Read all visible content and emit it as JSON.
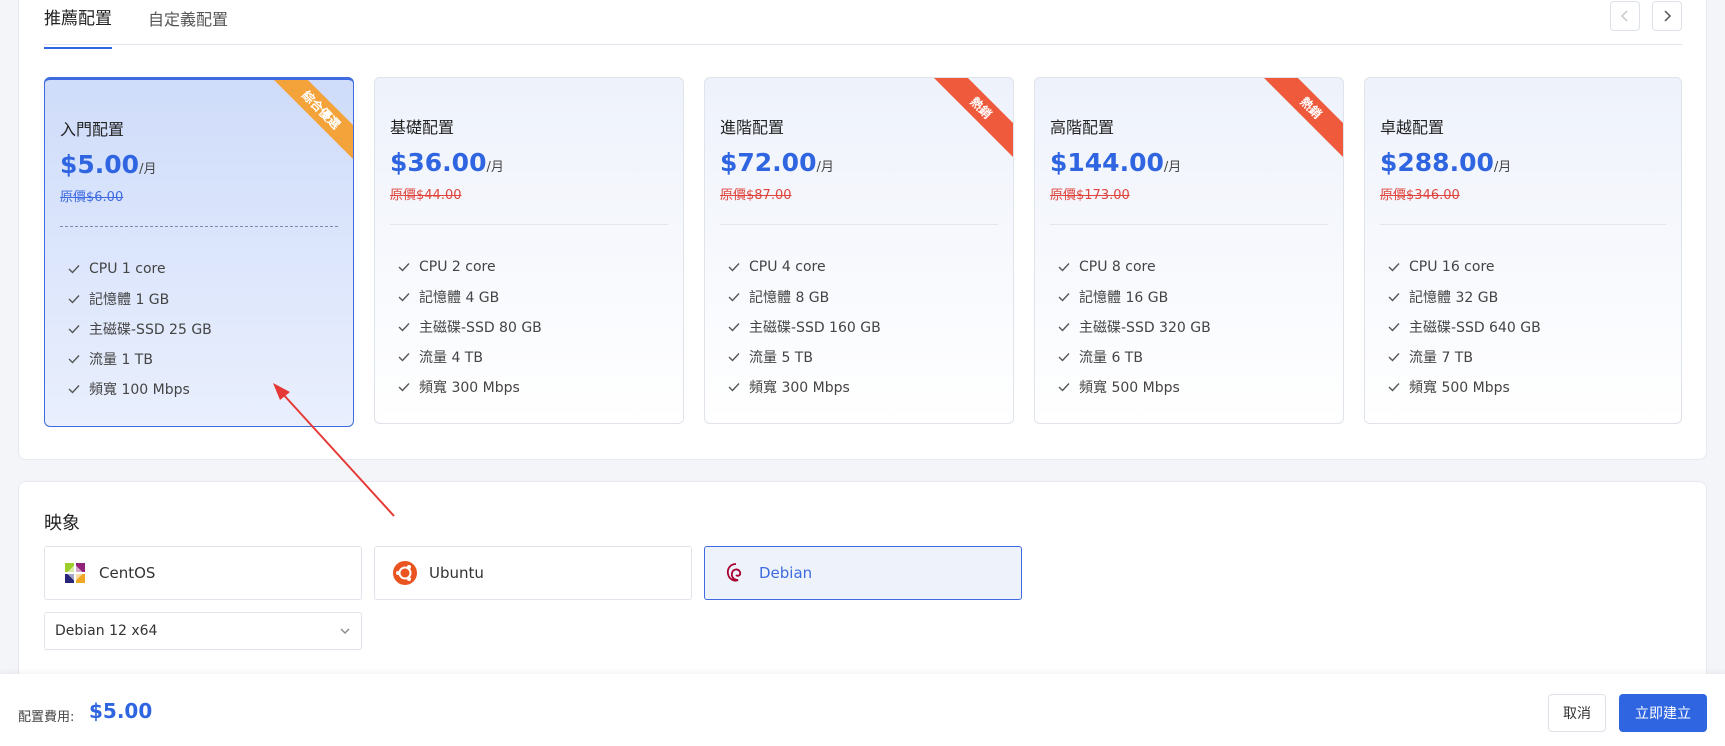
{
  "tabs": {
    "recommended": "推薦配置",
    "custom": "自定義配置"
  },
  "plans": [
    {
      "name": "入門配置",
      "price": "$5.00",
      "unit": "/月",
      "original": "原價$6.00",
      "ribbon": "綜合優選",
      "ribbon_color": "#f4a23a",
      "specs": [
        "CPU 1 core",
        "記憶體 1 GB",
        "主磁碟-SSD 25 GB",
        "流量 1 TB",
        "頻寬 100 Mbps"
      ],
      "selected": true
    },
    {
      "name": "基礎配置",
      "price": "$36.00",
      "unit": "/月",
      "original": "原價$44.00",
      "ribbon": "",
      "specs": [
        "CPU 2 core",
        "記憶體 4 GB",
        "主磁碟-SSD 80 GB",
        "流量 4 TB",
        "頻寬 300 Mbps"
      ]
    },
    {
      "name": "進階配置",
      "price": "$72.00",
      "unit": "/月",
      "original": "原價$87.00",
      "ribbon": "熱銷",
      "ribbon_color": "#ef5a3c",
      "specs": [
        "CPU 4 core",
        "記憶體 8 GB",
        "主磁碟-SSD 160 GB",
        "流量 5 TB",
        "頻寬 300 Mbps"
      ]
    },
    {
      "name": "高階配置",
      "price": "$144.00",
      "unit": "/月",
      "original": "原價$173.00",
      "ribbon": "熱銷",
      "ribbon_color": "#ef5a3c",
      "specs": [
        "CPU 8 core",
        "記憶體 16 GB",
        "主磁碟-SSD 320 GB",
        "流量 6 TB",
        "頻寬 500 Mbps"
      ]
    },
    {
      "name": "卓越配置",
      "price": "$288.00",
      "unit": "/月",
      "original": "原價$346.00",
      "ribbon": "",
      "specs": [
        "CPU 16 core",
        "記憶體 32 GB",
        "主磁碟-SSD 640 GB",
        "流量 7 TB",
        "頻寬 500 Mbps"
      ]
    }
  ],
  "image": {
    "title": "映象",
    "os_options": [
      {
        "label": "CentOS",
        "icon": "centos-icon"
      },
      {
        "label": "Ubuntu",
        "icon": "ubuntu-icon"
      },
      {
        "label": "Debian",
        "icon": "debian-icon",
        "selected": true
      }
    ],
    "version": "Debian 12 x64"
  },
  "footer": {
    "fee_label": "配置費用:",
    "fee_value": "$5.00",
    "cancel": "取消",
    "create": "立即建立"
  },
  "colors": {
    "accent": "#2f65e0",
    "discount": "#e0453d"
  }
}
